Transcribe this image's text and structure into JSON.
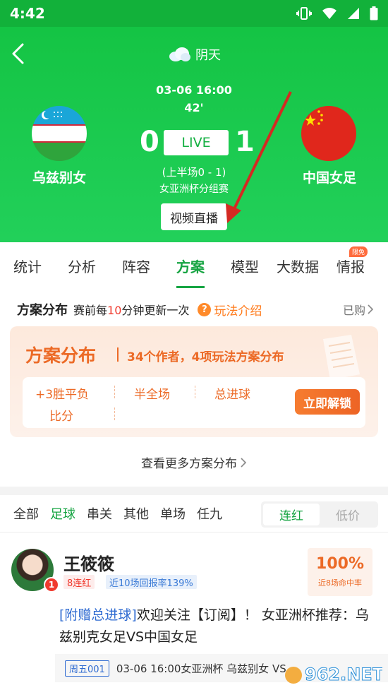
{
  "status_bar": {
    "time": "4:42"
  },
  "header": {
    "weather": "阴天",
    "match_time": "03-06 16:00",
    "minute": "42'",
    "home_score": "0",
    "away_score": "1",
    "live_label": "LIVE",
    "half_score": "(上半场0 - 1)",
    "league": "女亚洲杯分组赛",
    "video_button": "视频直播",
    "home_team": "乌兹别女",
    "away_team": "中国女足",
    "colors": {
      "header_green": "#14c444"
    }
  },
  "tabs": [
    {
      "label": "统计"
    },
    {
      "label": "分析"
    },
    {
      "label": "阵容"
    },
    {
      "label": "方案"
    },
    {
      "label": "模型"
    },
    {
      "label": "大数据"
    },
    {
      "label": "情报"
    }
  ],
  "tab_badge": "限免",
  "scheme": {
    "title": "方案分布",
    "desc_before": "赛前每",
    "desc_num": "10",
    "desc_after": "分钟更新一次",
    "help_label": "玩法介绍",
    "purchased": "已购",
    "promo_title": "方案分布",
    "promo_sub": "34个作者，4项玩法方案分布",
    "plays": [
      "+3胜平负",
      "半全场",
      "总进球",
      "比分"
    ],
    "unlock_button": "立即解锁",
    "more_link": "查看更多方案分布"
  },
  "filters": {
    "items": [
      "全部",
      "足球",
      "串关",
      "其他",
      "单场",
      "任九"
    ],
    "toggle": [
      "连红",
      "低价"
    ]
  },
  "expert": {
    "name": "王筱筱",
    "rank_badge": "1",
    "streak_tag": "8连红",
    "return_tag": "近10场回报率139%",
    "hit_rate": "100%",
    "hit_label": "近8场命中率",
    "post_link": "[附赠总进球]",
    "post_text": "欢迎关注【订阅】！ 女亚洲杯推荐：乌兹别克女足VS中国女足",
    "match_weekday": "周五001",
    "match_info": "03-06 16:00女亚洲杯   乌兹别女 VS"
  }
}
